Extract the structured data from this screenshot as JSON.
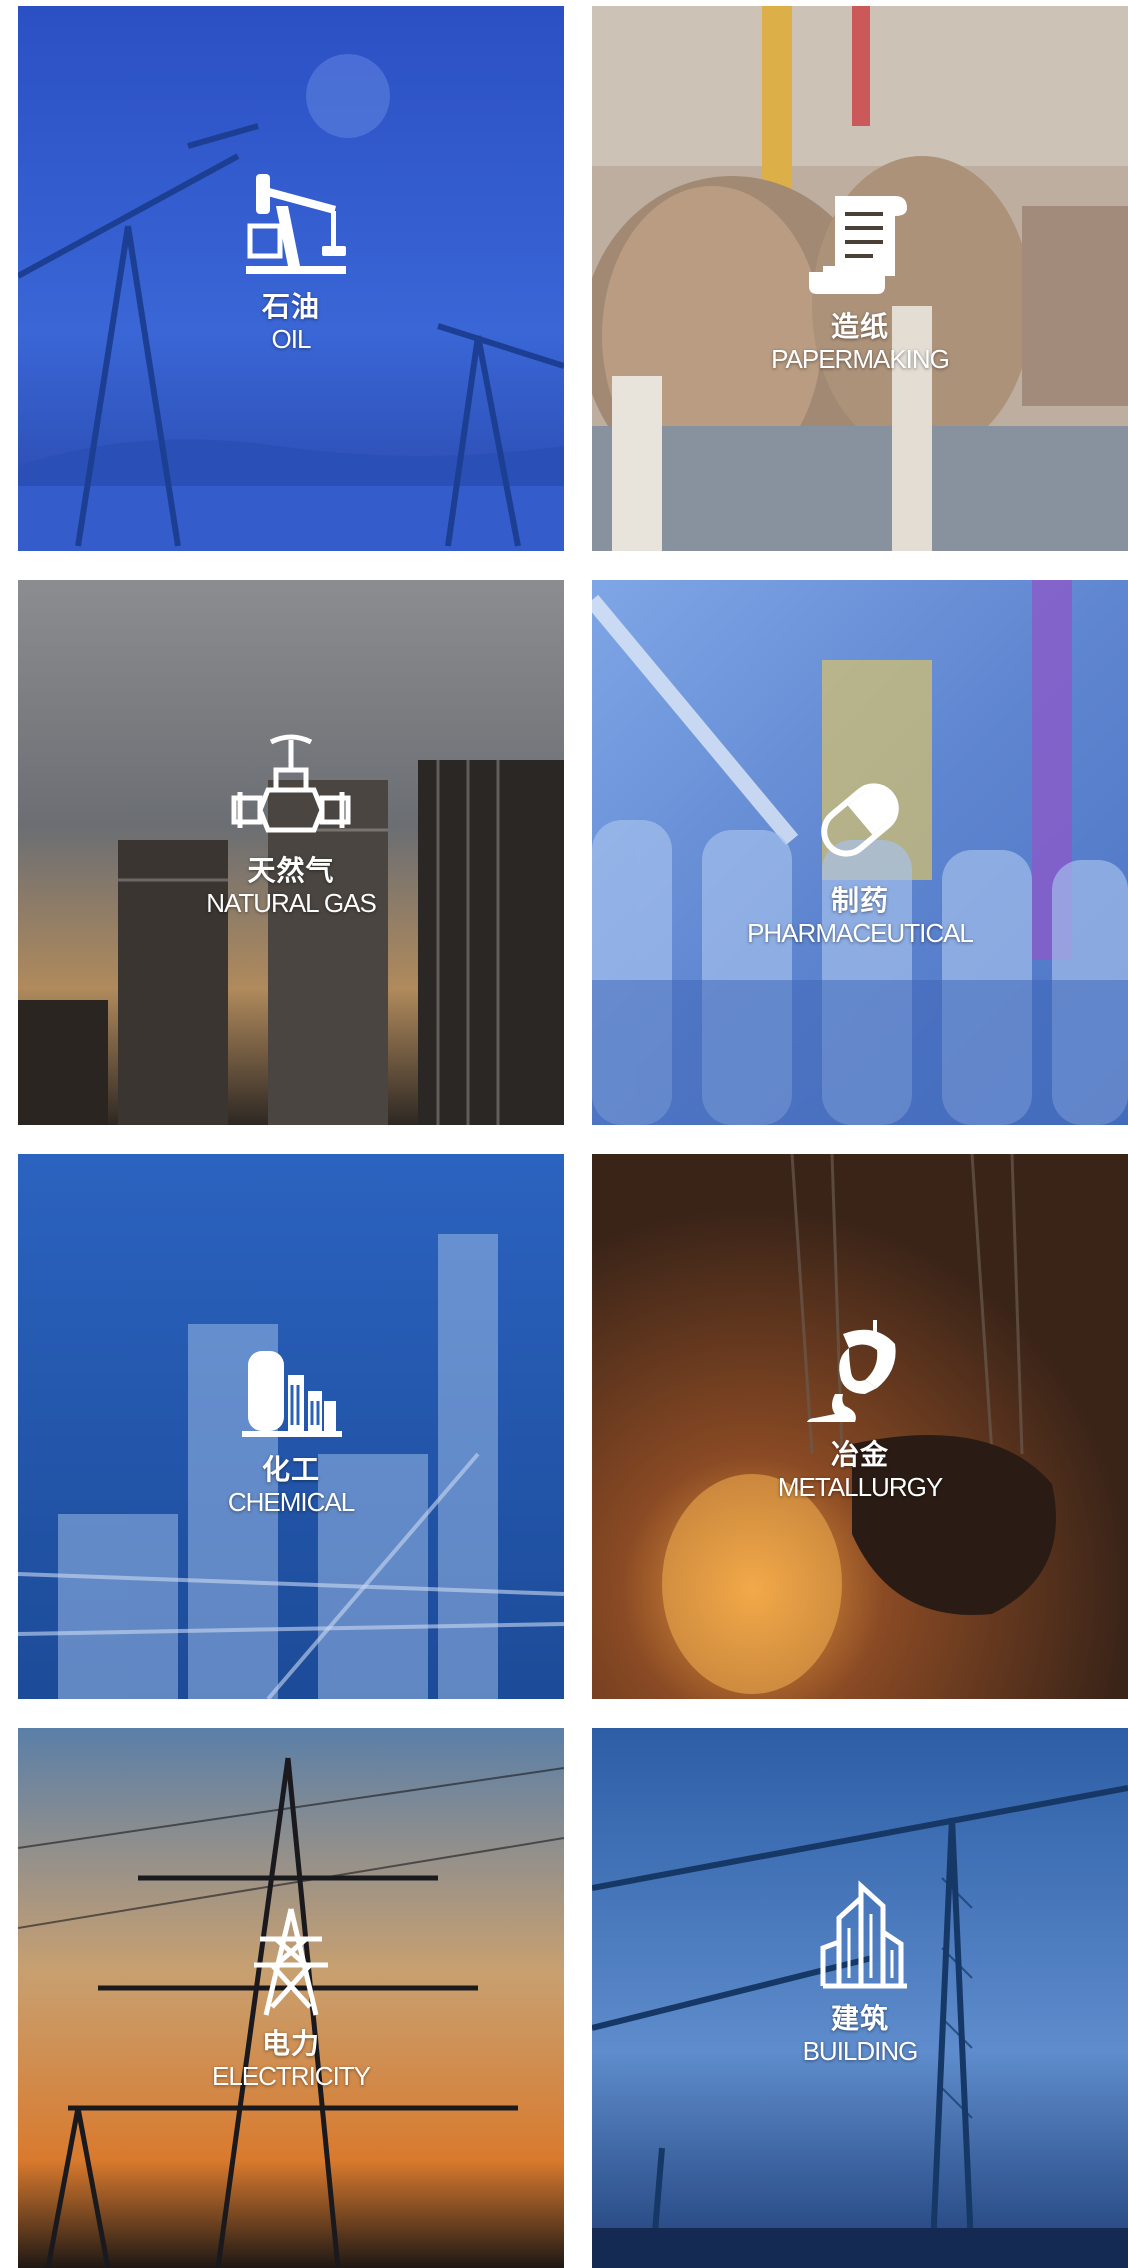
{
  "tiles": [
    {
      "id": "oil",
      "cn": "石油",
      "en": "OIL",
      "icon": "oil-pump-icon"
    },
    {
      "id": "paper",
      "cn": "造纸",
      "en": "PAPERMAKING",
      "icon": "paper-scroll-icon"
    },
    {
      "id": "gas",
      "cn": "天然气",
      "en": "NATURAL GAS",
      "icon": "valve-icon"
    },
    {
      "id": "pharma",
      "cn": "制药",
      "en": "PHARMACEUTICAL",
      "icon": "capsule-icon"
    },
    {
      "id": "chem",
      "cn": "化工",
      "en": "CHEMICAL",
      "icon": "chemical-plant-icon"
    },
    {
      "id": "metal",
      "cn": "冶金",
      "en": "METALLURGY",
      "icon": "ladle-icon"
    },
    {
      "id": "elec",
      "cn": "电力",
      "en": "ELECTRICITY",
      "icon": "power-tower-icon"
    },
    {
      "id": "build",
      "cn": "建筑",
      "en": "BUILDING",
      "icon": "buildings-icon"
    }
  ],
  "colors": {
    "oil": "#2c56c9",
    "paper": "#a88e78",
    "gas": "#5a5a5e",
    "pharma": "#5d86cf",
    "chem": "#2a62b8",
    "metal": "#6b3a1e",
    "elec": "#c87a36",
    "build": "#2f5fa8",
    "text": "#ffffff"
  }
}
